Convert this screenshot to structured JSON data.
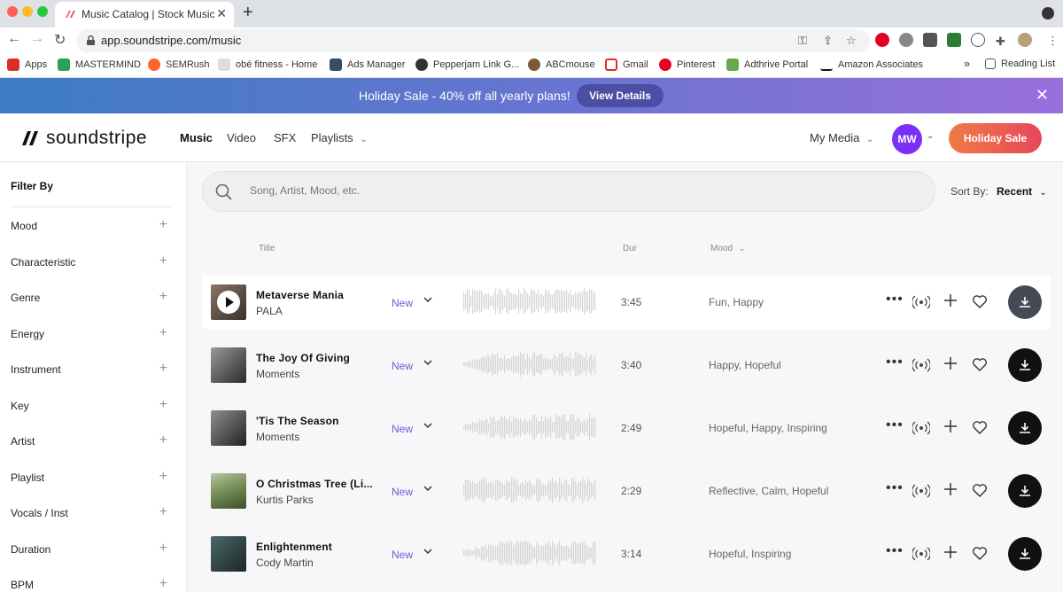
{
  "browser": {
    "tab_title": "Music Catalog | Stock Music | ",
    "url": "app.soundstripe.com/music",
    "bookmarks": [
      {
        "label": "Apps",
        "icon": "apps-grid-icon",
        "color": "#d93025"
      },
      {
        "label": "MASTERMIND",
        "icon": "mastermind-icon",
        "color": "#2e9e5b"
      },
      {
        "label": "SEMRush",
        "icon": "semrush-icon",
        "color": "#ff642d"
      },
      {
        "label": "obé fitness - Home",
        "icon": "obe-icon",
        "color": "#cccccc"
      },
      {
        "label": "Ads Manager",
        "icon": "ads-manager-icon",
        "color": "#3b4a68"
      },
      {
        "label": "Pepperjam Link G...",
        "icon": "globe-icon",
        "color": "#333333"
      },
      {
        "label": "ABCmouse",
        "icon": "abcmouse-icon",
        "color": "#7a5a3a"
      },
      {
        "label": "Gmail",
        "icon": "gmail-icon",
        "color": "#d93025"
      },
      {
        "label": "Pinterest",
        "icon": "pinterest-icon",
        "color": "#e60023"
      },
      {
        "label": "Adthrive Portal",
        "icon": "adthrive-icon",
        "color": "#6aa84f"
      },
      {
        "label": "Amazon Associates",
        "icon": "amazon-icon",
        "color": "#111111"
      }
    ],
    "more_bookmarks": "»",
    "reading_list": "Reading List"
  },
  "promo": {
    "text": "Holiday Sale - 40% off all yearly plans!",
    "button": "View Details"
  },
  "header": {
    "logo": "soundstripe",
    "nav": [
      "Music",
      "Video",
      "SFX",
      "Playlists"
    ],
    "my_media": "My Media",
    "avatar": "MW",
    "cta": "Holiday Sale",
    "accent": "#e8475c"
  },
  "sidebar": {
    "title": "Filter By",
    "filters": [
      "Mood",
      "Characteristic",
      "Genre",
      "Energy",
      "Instrument",
      "Key",
      "Artist",
      "Playlist",
      "Vocals / Inst",
      "Duration",
      "BPM"
    ]
  },
  "main": {
    "search_placeholder": "Song, Artist, Mood, etc.",
    "sort_label": "Sort By:",
    "sort_value": "Recent",
    "columns": {
      "title": "Title",
      "dur": "Dur",
      "mood": "Mood"
    },
    "tracks": [
      {
        "title": "Metaverse Mania",
        "artist": "PALA",
        "badge": "New",
        "duration": "3:45",
        "mood": "Fun, Happy"
      },
      {
        "title": "The Joy Of Giving",
        "artist": "Moments",
        "badge": "New",
        "duration": "3:40",
        "mood": "Happy, Hopeful"
      },
      {
        "title": "'Tis The Season",
        "artist": "Moments",
        "badge": "New",
        "duration": "2:49",
        "mood": "Hopeful, Happy, Inspiring"
      },
      {
        "title": "O Christmas Tree (Li...",
        "artist": "Kurtis Parks",
        "badge": "New",
        "duration": "2:29",
        "mood": "Reflective, Calm, Hopeful"
      },
      {
        "title": "Enlightenment",
        "artist": "Cody Martin",
        "badge": "New",
        "duration": "3:14",
        "mood": "Hopeful, Inspiring"
      }
    ]
  }
}
